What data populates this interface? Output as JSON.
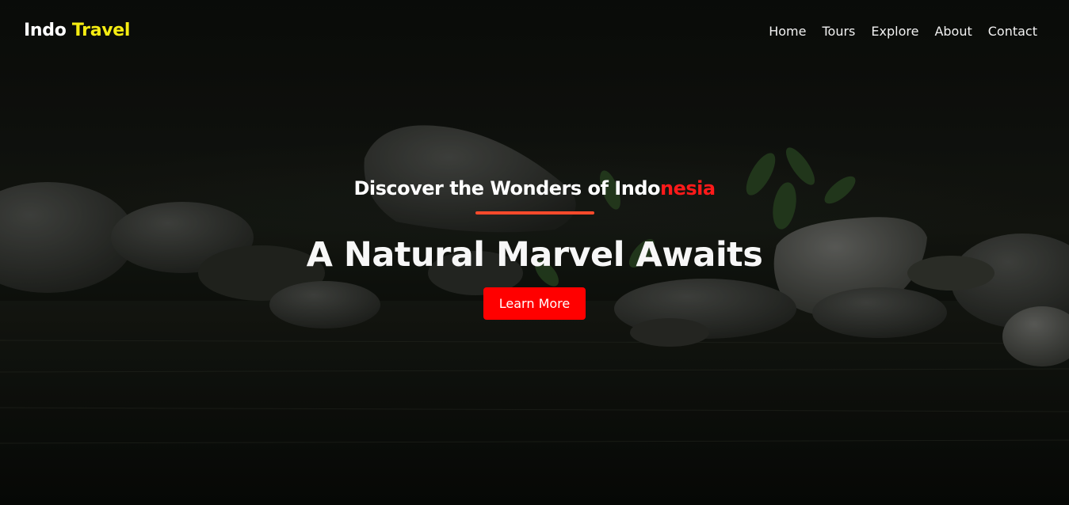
{
  "brand": {
    "name_main": "Indo",
    "name_accent": "Travel"
  },
  "nav": {
    "items": [
      {
        "label": "Home"
      },
      {
        "label": "Tours"
      },
      {
        "label": "Explore"
      },
      {
        "label": "About"
      },
      {
        "label": "Contact"
      }
    ]
  },
  "hero": {
    "subtitle_main": "Discover the Wonders of Indo",
    "subtitle_accent": "nesia",
    "headline": "A Natural Marvel Awaits",
    "cta_label": "Learn More"
  },
  "colors": {
    "brand_accent": "#f5ec12",
    "subtitle_accent": "#ff1a1a",
    "divider": "#ff4a2b",
    "cta_background": "#ff0000"
  },
  "icons": [
    "river-rocks-background-image"
  ]
}
